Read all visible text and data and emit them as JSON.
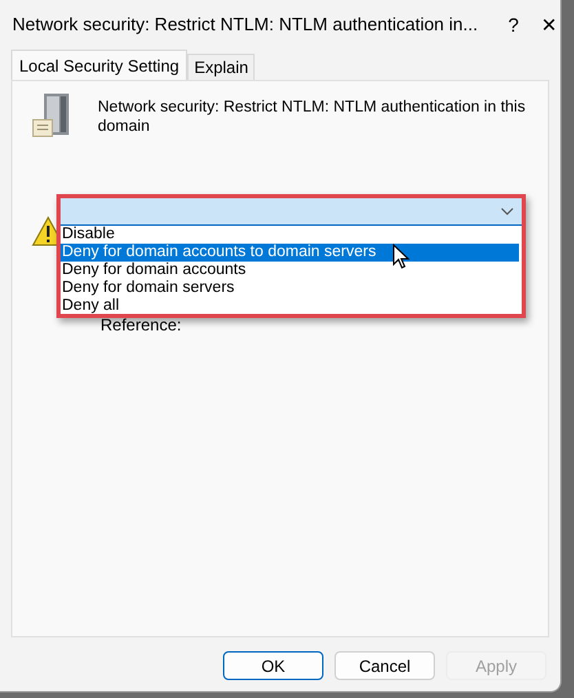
{
  "window": {
    "title": "Network security: Restrict NTLM: NTLM authentication in...",
    "help": "?",
    "close": "✕"
  },
  "tabs": [
    {
      "label": "Local Security Setting",
      "selected": true
    },
    {
      "label": "Explain",
      "selected": false
    }
  ],
  "policy": {
    "name": "Network security: Restrict NTLM: NTLM authentication in this domain"
  },
  "dropdown": {
    "expanded": true,
    "options": [
      {
        "label": "Disable",
        "selected": false
      },
      {
        "label": "Deny for domain accounts to domain servers",
        "selected": true
      },
      {
        "label": "Deny for domain accounts",
        "selected": false
      },
      {
        "label": "Deny for domain servers",
        "selected": false
      },
      {
        "label": "Deny all",
        "selected": false
      }
    ]
  },
  "warning": {
    "text": "Reference:"
  },
  "buttons": [
    {
      "label": "OK",
      "disabled": false,
      "default": true
    },
    {
      "label": "Cancel",
      "disabled": false,
      "default": false
    },
    {
      "label": "Apply",
      "disabled": true,
      "default": false
    }
  ]
}
